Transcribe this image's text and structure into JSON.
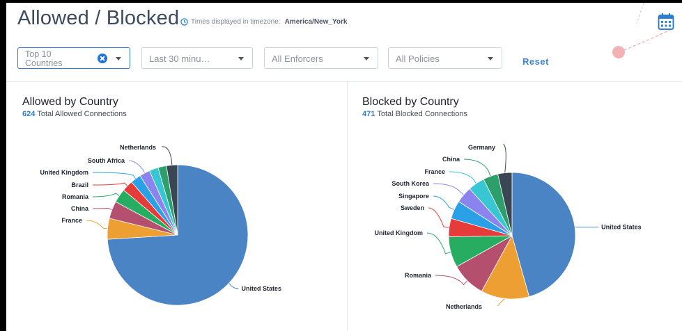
{
  "header": {
    "title": "Allowed / Blocked",
    "timezone_prefix": "Times displayed in timezone:",
    "timezone": "America/New_York"
  },
  "filters": {
    "country": "Top 10 Countries",
    "time": "Last 30 minu…",
    "enforcers": "All Enforcers",
    "policies": "All Policies",
    "reset": "Reset"
  },
  "icons": {
    "clock": "clock-icon",
    "calendar": "calendar-icon",
    "clear": "clear-icon",
    "caret": "chevron-down-icon"
  },
  "colors": {
    "accent": "#2f7fd0",
    "title": "#3c4a5d"
  },
  "chart_data": [
    {
      "type": "pie",
      "title": "Allowed by Country",
      "subtitle_count": "624",
      "subtitle_label": "Total Allowed Connections",
      "slices": [
        {
          "label": "United States",
          "value": 462,
          "color": "#4a84c4"
        },
        {
          "label": "France",
          "value": 30,
          "color": "#ee9f33"
        },
        {
          "label": "China",
          "value": 25,
          "color": "#b4506d"
        },
        {
          "label": "Romania",
          "value": 20,
          "color": "#27ad62"
        },
        {
          "label": "Brazil",
          "value": 16,
          "color": "#e63b3b"
        },
        {
          "label": "United Kingdom",
          "value": 15,
          "color": "#2aa1e6"
        },
        {
          "label": "South Africa",
          "value": 15,
          "color": "#8b83ee"
        },
        {
          "label": "",
          "value": 13,
          "color": "#38c6d3"
        },
        {
          "label": "",
          "value": 12,
          "color": "#2d9f6b"
        },
        {
          "label": "Netherlands",
          "value": 16,
          "color": "#3b4654"
        }
      ]
    },
    {
      "type": "pie",
      "title": "Blocked by Country",
      "subtitle_count": "471",
      "subtitle_label": "Total Blocked Connections",
      "slices": [
        {
          "label": "United States",
          "value": 215,
          "color": "#4a84c4"
        },
        {
          "label": "Netherlands",
          "value": 58,
          "color": "#ee9f33"
        },
        {
          "label": "Romania",
          "value": 42,
          "color": "#b4506d"
        },
        {
          "label": "United Kingdom",
          "value": 37,
          "color": "#27ad62"
        },
        {
          "label": "Sweden",
          "value": 22,
          "color": "#e63b3b"
        },
        {
          "label": "Singapore",
          "value": 22,
          "color": "#2aa1e6"
        },
        {
          "label": "South Korea",
          "value": 20,
          "color": "#8b83ee"
        },
        {
          "label": "France",
          "value": 20,
          "color": "#38c6d3"
        },
        {
          "label": "China",
          "value": 18,
          "color": "#2d9f6b"
        },
        {
          "label": "Germany",
          "value": 17,
          "color": "#3b4654"
        }
      ]
    }
  ]
}
